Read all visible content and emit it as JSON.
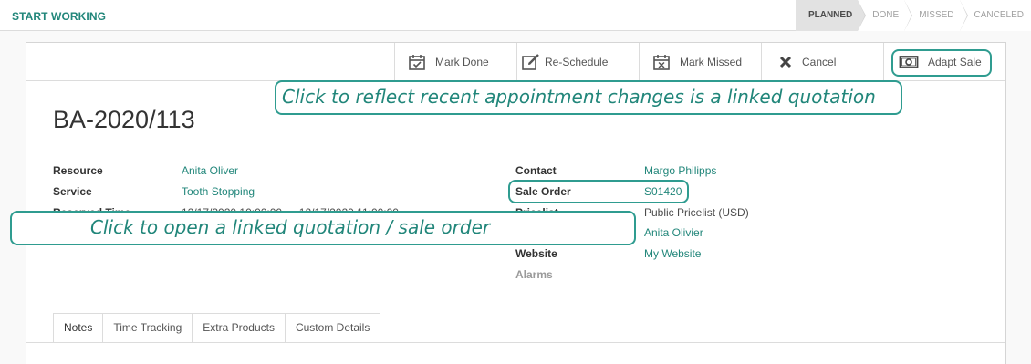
{
  "topbar": {
    "start_label": "START WORKING",
    "stages": [
      {
        "label": "PLANNED",
        "active": true
      },
      {
        "label": "DONE",
        "active": false
      },
      {
        "label": "MISSED",
        "active": false
      },
      {
        "label": "CANCELED",
        "active": false
      }
    ]
  },
  "buttons": {
    "mark_done": "Mark Done",
    "reschedule": "Re-Schedule",
    "mark_missed": "Mark Missed",
    "cancel": "Cancel",
    "adapt_sale": "Adapt Sale"
  },
  "record": {
    "title": "BA-2020/113",
    "left": {
      "resource_label": "Resource",
      "resource_value": "Anita Oliver",
      "service_label": "Service",
      "service_value": "Tooth Stopping",
      "time_label": "Reserved Time",
      "time_value": "12/17/2020 10:00:00 → 12/17/2020 11:00:00"
    },
    "right": {
      "contact_label": "Contact",
      "contact_value": "Margo Philipps",
      "sale_order_label": "Sale Order",
      "sale_order_value": "S01420",
      "pricelist_label": "Pricelist",
      "pricelist_value": "Public Pricelist (USD)",
      "salesperson_value": "Anita Olivier",
      "website_label": "Website",
      "website_value": "My Website",
      "alarms_label": "Alarms"
    }
  },
  "tabs": [
    "Notes",
    "Time Tracking",
    "Extra Products",
    "Custom Details"
  ],
  "callouts": {
    "adapt_sale": "Click to reflect recent appointment changes is a linked quotation",
    "sale_order": "Click to open a linked quotation / sale order"
  },
  "colors": {
    "accent": "#21867a",
    "callout_border": "#2f9c90",
    "active_stage": "#e2e2e2"
  }
}
